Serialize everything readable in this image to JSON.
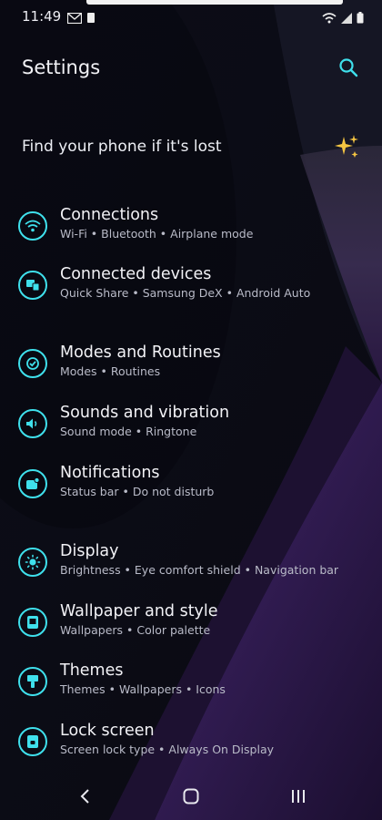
{
  "status_bar": {
    "time": "11:49",
    "left_icons": [
      "gmail-icon",
      "battery-small-icon"
    ],
    "right_icons": [
      "wifi-icon",
      "signal-icon",
      "battery-icon"
    ]
  },
  "header": {
    "title": "Settings",
    "search_icon": "search-icon"
  },
  "suggestion": {
    "label": "Find your phone if it's lost",
    "icon": "sparkle-icon"
  },
  "items": [
    {
      "title": "Connections",
      "subtitle": "Wi-Fi  •  Bluetooth  •  Airplane mode",
      "icon": "wifi-icon"
    },
    {
      "title": "Connected devices",
      "subtitle": "Quick Share  •  Samsung DeX  •  Android Auto",
      "icon": "devices-icon"
    },
    {
      "title": "Modes and Routines",
      "subtitle": "Modes  •  Routines",
      "icon": "check-circle-icon"
    },
    {
      "title": "Sounds and vibration",
      "subtitle": "Sound mode  •  Ringtone",
      "icon": "speaker-icon"
    },
    {
      "title": "Notifications",
      "subtitle": "Status bar  •  Do not disturb",
      "icon": "notification-icon"
    },
    {
      "title": "Display",
      "subtitle": "Brightness  •  Eye comfort shield  •  Navigation bar",
      "icon": "brightness-icon"
    },
    {
      "title": "Wallpaper and style",
      "subtitle": "Wallpapers  •  Color palette",
      "icon": "wallpaper-icon"
    },
    {
      "title": "Themes",
      "subtitle": "Themes  •  Wallpapers  •  Icons",
      "icon": "brush-icon"
    },
    {
      "title": "Lock screen",
      "subtitle": "Screen lock type  •  Always On Display",
      "icon": "lock-icon"
    }
  ],
  "nav_bar": {
    "back": "back-icon",
    "home": "home-icon",
    "recents": "recents-icon"
  },
  "colors": {
    "accent": "#3fe0ec",
    "background": "#0a0b14",
    "purple": "#3a1a5c"
  }
}
